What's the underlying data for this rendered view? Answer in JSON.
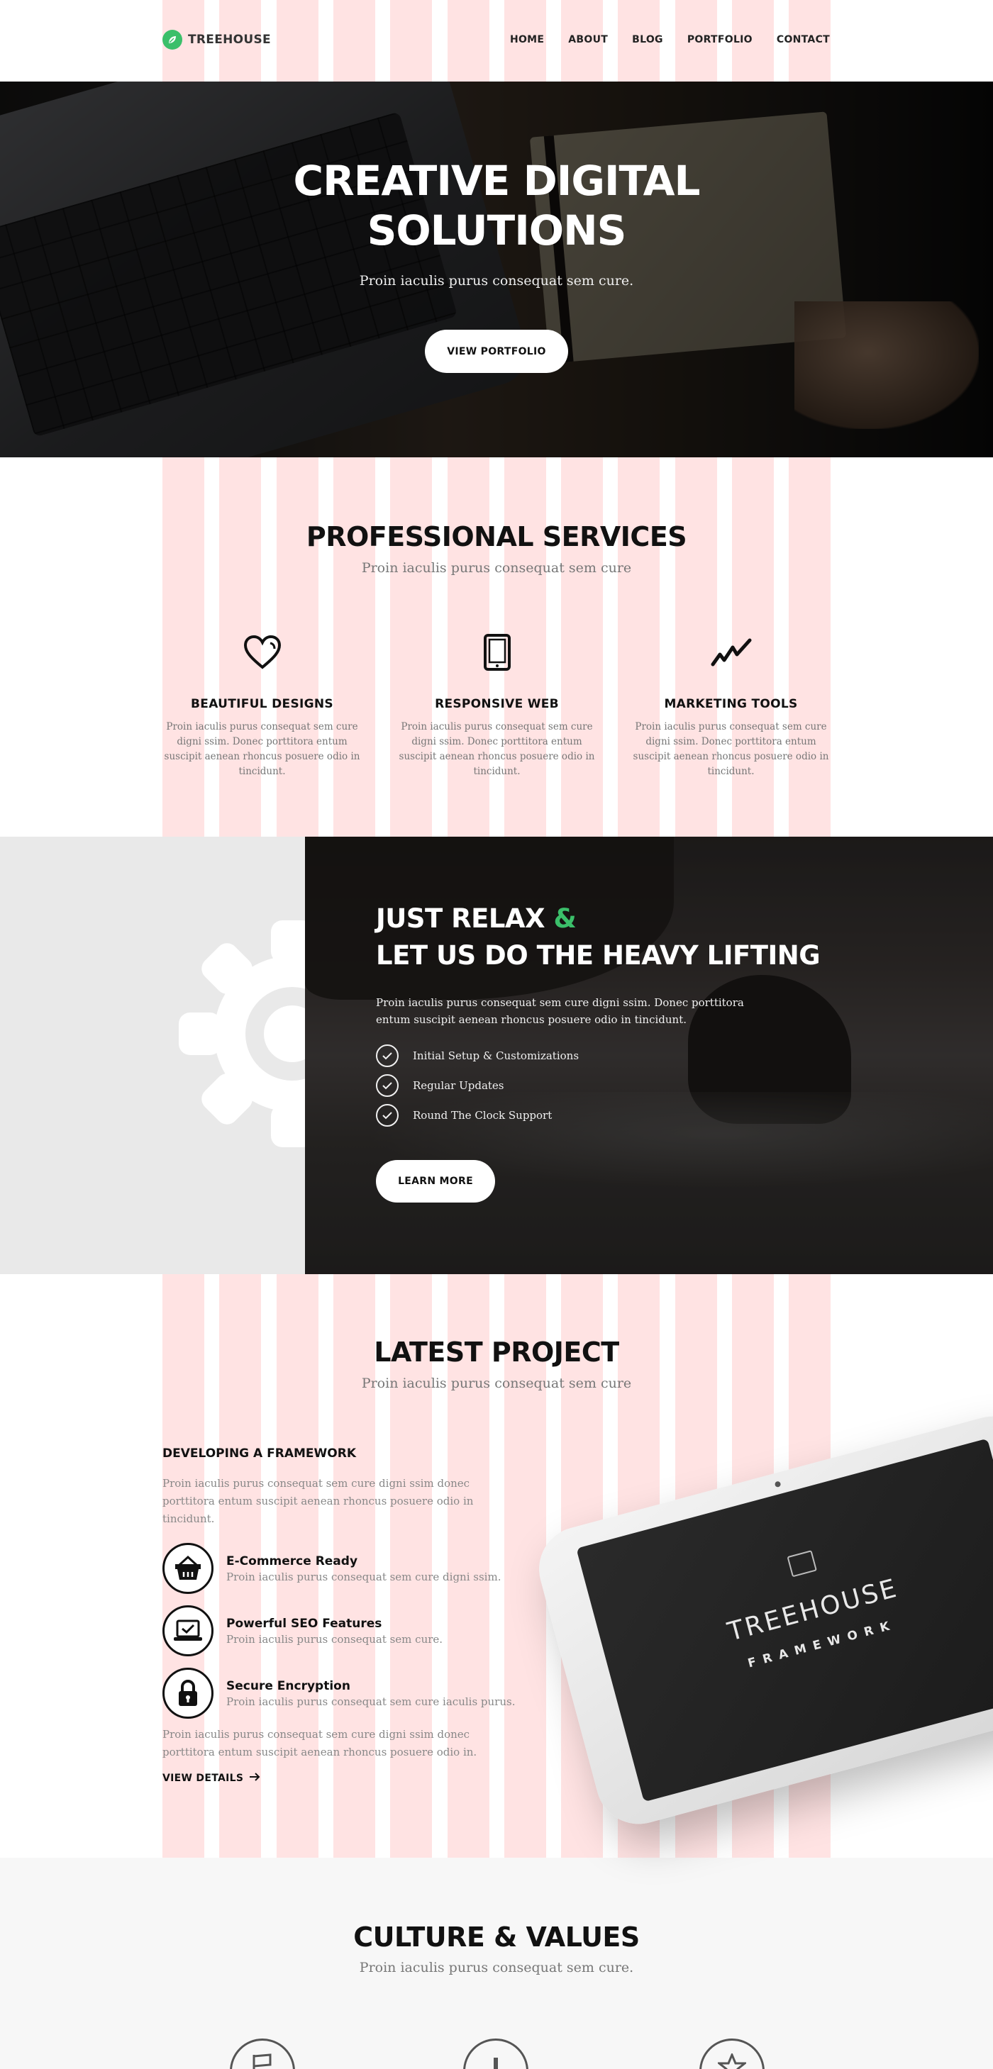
{
  "header": {
    "logo_text": "TREEHOUSE",
    "nav": [
      {
        "label": "HOME"
      },
      {
        "label": "ABOUT"
      },
      {
        "label": "BLOG"
      },
      {
        "label": "PORTFOLIO"
      },
      {
        "label": "CONTACT"
      }
    ]
  },
  "hero": {
    "title_line1": "CREATIVE DIGITAL",
    "title_line2": "SOLUTIONS",
    "subtitle": "Proin iaculis purus consequat sem cure.",
    "button_label": "VIEW PORTFOLIO"
  },
  "services": {
    "title": "PROFESSIONAL SERVICES",
    "subtitle": "Proin iaculis purus consequat sem cure",
    "items": [
      {
        "icon": "heart-icon",
        "title": "BEAUTIFUL DESIGNS",
        "desc": "Proin iaculis purus consequat sem cure digni ssim. Donec porttitora entum suscipit aenean rhoncus posuere odio in tincidunt."
      },
      {
        "icon": "tablet-icon",
        "title": "RESPONSIVE WEB",
        "desc": "Proin iaculis purus consequat sem cure digni ssim. Donec porttitora entum suscipit aenean rhoncus posuere odio in tincidunt."
      },
      {
        "icon": "chart-line-icon",
        "title": "MARKETING TOOLS",
        "desc": "Proin iaculis purus consequat sem cure digni ssim. Donec porttitora entum suscipit aenean rhoncus posuere odio in tincidunt."
      }
    ]
  },
  "relax": {
    "heading_part1": "JUST RELAX ",
    "heading_amp": "&",
    "heading_line2": "LET US DO THE HEAVY LIFTING",
    "text": "Proin iaculis purus consequat sem cure  digni ssim. Donec porttitora entum suscipit  aenean rhoncus posuere odio in tincidunt.",
    "checklist": [
      {
        "label": "Initial Setup & Customizations"
      },
      {
        "label": "Regular Updates"
      },
      {
        "label": "Round The Clock Support"
      }
    ],
    "button_label": "LEARN MORE"
  },
  "project": {
    "title": "LATEST PROJECT",
    "subtitle": "Proin iaculis purus consequat sem cure",
    "heading": "DEVELOPING A FRAMEWORK",
    "text": "Proin iaculis purus consequat sem cure  digni ssim donec porttitora entum suscipit  aenean rhoncus posuere odio in tincidunt.",
    "features": [
      {
        "icon": "basket-icon",
        "title": "E-Commerce Ready",
        "desc": "Proin iaculis purus consequat sem cure  digni ssim."
      },
      {
        "icon": "laptop-check-icon",
        "title": "Powerful SEO Features",
        "desc": "Proin iaculis purus consequat sem cure."
      },
      {
        "icon": "lock-icon",
        "title": "Secure Encryption",
        "desc": "Proin iaculis purus consequat sem cure iaculis purus."
      }
    ],
    "text2": "Proin iaculis purus consequat sem cure  digni ssim donec porttitora entum suscipit  aenean rhoncus posuere odio in.",
    "link_label": "VIEW DETAILS",
    "tablet_brand": "TREEHOUSE",
    "tablet_sub": "FRAMEWORK"
  },
  "culture": {
    "title": "CULTURE & VALUES",
    "subtitle": "Proin iaculis purus consequat sem cure.",
    "icons": [
      "flag-icon",
      "bar-chart-icon",
      "star-icon"
    ]
  },
  "colors": {
    "accent": "#3bbf6a",
    "grid_overlay": "#ffb6b6"
  }
}
